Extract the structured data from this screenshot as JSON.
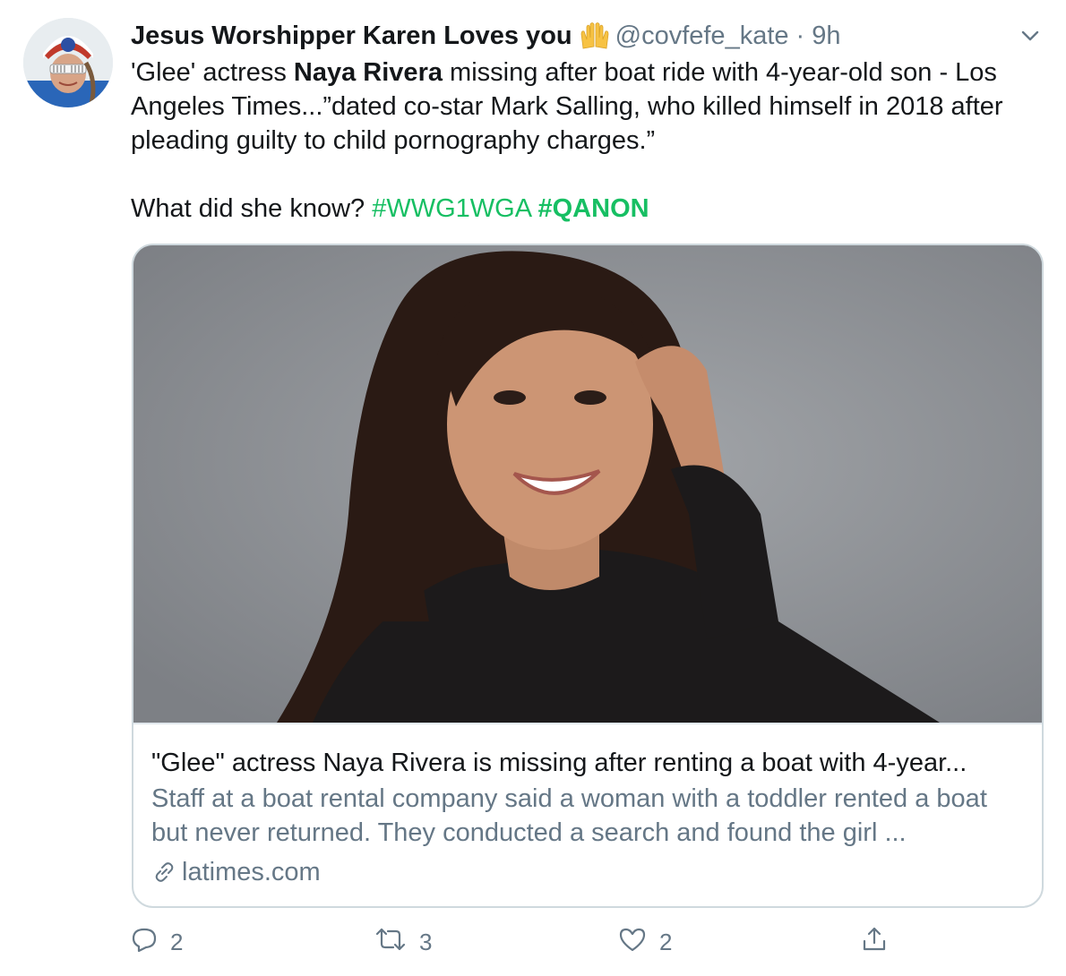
{
  "tweet": {
    "author_name": "Jesus Worshipper Karen Loves you",
    "author_emoji": "🙌",
    "handle": "@covfefe_kate",
    "separator": "·",
    "time": "9h",
    "text": {
      "line1_prefix": "'Glee' actress ",
      "line1_bold": "Naya Rivera",
      "line1_suffix": " missing after boat ride with 4-year-old son - Los Angeles Times...”dated co-star Mark Salling, who killed himself in 2018 after pleading guilty to child pornography charges.”",
      "question": "What did she know? ",
      "hashtag1": "#WWG1WGA",
      "hashtag2": "#QANON"
    }
  },
  "card": {
    "title": "\"Glee\" actress Naya Rivera is missing after renting a boat with 4-year...",
    "description": "Staff at a boat rental company said a woman with a toddler rented a boat but never returned. They conducted a search and found the girl ...",
    "domain": "latimes.com",
    "image_icon": "portrait-photo"
  },
  "actions": {
    "reply_count": "2",
    "retweet_count": "3",
    "like_count": "2"
  },
  "colors": {
    "hashtag": "#17bf63",
    "secondary_text": "#657786",
    "border": "#cfd9de"
  }
}
